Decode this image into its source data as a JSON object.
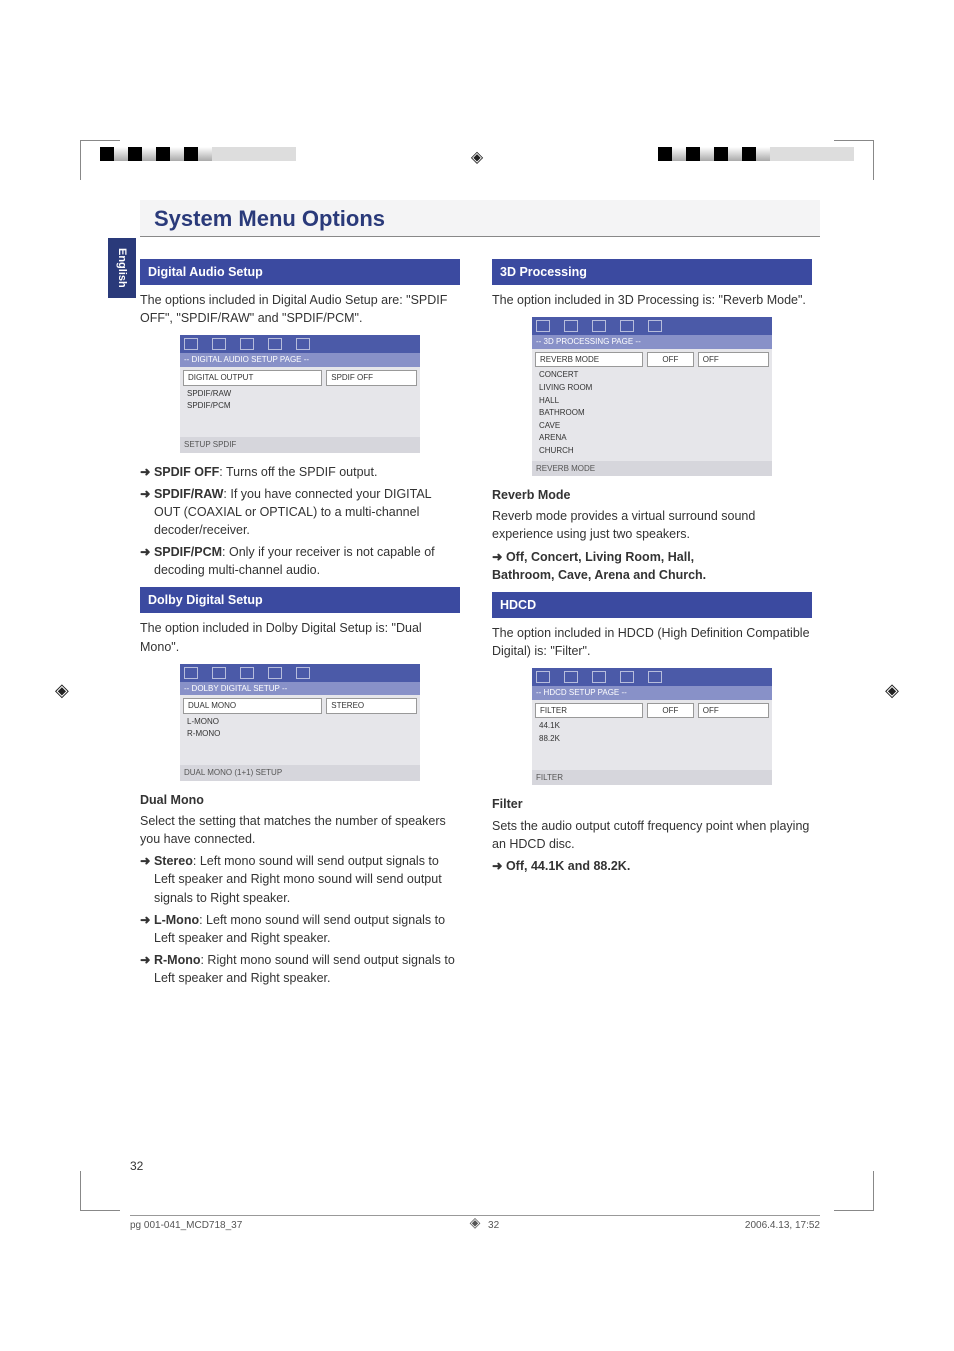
{
  "language_tab": "English",
  "page_title": "System Menu Options",
  "left": {
    "sec1": {
      "head": "Digital Audio Setup",
      "intro": "The options included in Digital Audio Setup are: \"SPDIF OFF\", \"SPDIF/RAW\" and \"SPDIF/PCM\".",
      "menu": {
        "title": "-- DIGITAL AUDIO SETUP PAGE --",
        "row_label": "DIGITAL OUTPUT",
        "opt1": "SPDIF OFF",
        "opt2": "SPDIF/RAW",
        "opt3": "SPDIF/PCM",
        "footer": "SETUP SPDIF"
      },
      "b1_label": "SPDIF OFF",
      "b1_text": ": Turns off the SPDIF output.",
      "b2_label": "SPDIF/RAW",
      "b2_text": ": If you have connected your DIGITAL OUT (COAXIAL or OPTICAL) to a multi-channel decoder/receiver.",
      "b3_label": "SPDIF/PCM",
      "b3_text": ": Only if your receiver is not capable of decoding multi-channel audio."
    },
    "sec2": {
      "head": "Dolby Digital Setup",
      "intro": "The option included in Dolby Digital Setup is: \"Dual Mono\".",
      "menu": {
        "title": "-- DOLBY DIGITAL SETUP --",
        "row_label": "DUAL MONO",
        "opt1": "STEREO",
        "opt2": "L-MONO",
        "opt3": "R-MONO",
        "footer": "DUAL MONO (1+1) SETUP"
      },
      "sub": "Dual Mono",
      "desc": "Select the setting that matches the number of speakers you have connected.",
      "b1_label": "Stereo",
      "b1_text": ": Left mono sound will send output signals to Left speaker and Right mono sound will send output signals to Right speaker.",
      "b2_label": "L-Mono",
      "b2_text": ": Left mono sound will send output signals to Left speaker and Right speaker.",
      "b3_label": "R-Mono",
      "b3_text": ": Right mono sound will send output signals to Left speaker and Right speaker."
    }
  },
  "right": {
    "sec1": {
      "head": "3D Processing",
      "intro": "The option included in 3D Processing is: \"Reverb Mode\".",
      "menu": {
        "title": "-- 3D PROCESSING PAGE --",
        "row_label": "REVERB MODE",
        "mid": "OFF",
        "opts": [
          "OFF",
          "CONCERT",
          "LIVING ROOM",
          "HALL",
          "BATHROOM",
          "CAVE",
          "ARENA",
          "CHURCH"
        ],
        "footer": "REVERB MODE"
      },
      "sub": "Reverb Mode",
      "desc": "Reverb mode provides a virtual surround sound experience using just two speakers.",
      "opts_line1_prefix": "➜ ",
      "opts_line1": "Off, Concert, Living Room, Hall,",
      "opts_line2": "Bathroom, Cave, Arena and Church."
    },
    "sec2": {
      "head": "HDCD",
      "intro": "The option included in HDCD (High Definition Compatible Digital) is: \"Filter\".",
      "menu": {
        "title": "-- HDCD SETUP PAGE --",
        "row_label": "FILTER",
        "mid": "OFF",
        "opts": [
          "OFF",
          "44.1K",
          "88.2K"
        ],
        "footer": "FILTER"
      },
      "sub": "Filter",
      "desc": "Sets the audio output cutoff frequency point when playing an HDCD disc.",
      "opts_line_prefix": "➜ ",
      "opts_line": "Off, 44.1K and 88.2K."
    }
  },
  "page_number": "32",
  "footer": {
    "left": "pg 001-041_MCD718_37",
    "center": "32",
    "right": "2006.4.13, 17:52"
  },
  "arrow": "➜"
}
